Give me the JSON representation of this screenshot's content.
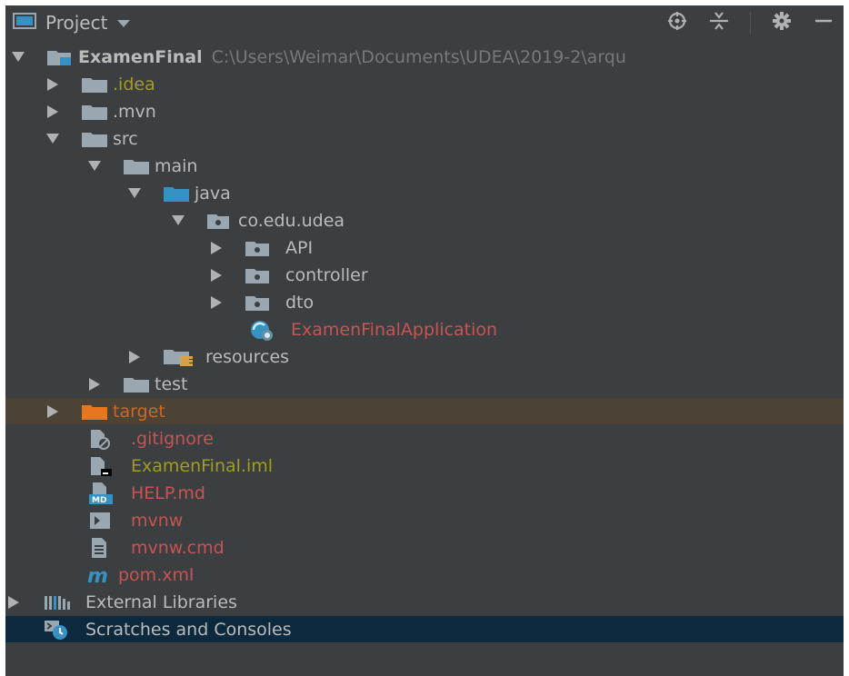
{
  "window": {
    "title": "Project"
  },
  "toolbar": {
    "icons": [
      "crosshair-icon",
      "collapse-all-icon",
      "gear-icon",
      "minimize-icon"
    ]
  },
  "tree": [
    {
      "name": "ExamenFinal",
      "path": "C:\\Users\\Weimar\\Documents\\UDEA\\2019-2\\arqu",
      "icon": "project-folder-icon",
      "expanded": true,
      "color": "#bbbbbb"
    },
    {
      "name": ".idea",
      "icon": "folder-icon",
      "expanded": false,
      "color": "#a29d1e"
    },
    {
      "name": ".mvn",
      "icon": "folder-icon",
      "expanded": false,
      "color": "#bbbbbb"
    },
    {
      "name": "src",
      "icon": "folder-icon",
      "expanded": true,
      "color": "#bbbbbb"
    },
    {
      "name": "main",
      "icon": "folder-icon",
      "expanded": true,
      "color": "#bbbbbb"
    },
    {
      "name": "java",
      "icon": "source-folder-icon",
      "expanded": true,
      "color": "#bbbbbb"
    },
    {
      "name": "co.edu.udea",
      "icon": "package-icon",
      "expanded": true,
      "color": "#bbbbbb"
    },
    {
      "name": "API",
      "icon": "package-icon",
      "expanded": false,
      "color": "#bbbbbb"
    },
    {
      "name": "controller",
      "icon": "package-icon",
      "expanded": false,
      "color": "#bbbbbb"
    },
    {
      "name": "dto",
      "icon": "package-icon",
      "expanded": false,
      "color": "#bbbbbb"
    },
    {
      "name": "ExamenFinalApplication",
      "icon": "spring-boot-class-icon",
      "color": "#c75450"
    },
    {
      "name": "resources",
      "icon": "resources-folder-icon",
      "expanded": false,
      "color": "#bbbbbb"
    },
    {
      "name": "test",
      "icon": "folder-icon",
      "expanded": false,
      "color": "#bbbbbb"
    },
    {
      "name": "target",
      "icon": "excluded-folder-icon",
      "expanded": false,
      "color": "#d1661f"
    },
    {
      "name": ".gitignore",
      "icon": "ignore-file-icon",
      "color": "#c75450"
    },
    {
      "name": "ExamenFinal.iml",
      "icon": "iml-file-icon",
      "color": "#a29d1e"
    },
    {
      "name": "HELP.md",
      "icon": "markdown-file-icon",
      "color": "#c75450"
    },
    {
      "name": "mvnw",
      "icon": "shell-script-icon",
      "color": "#c75450"
    },
    {
      "name": "mvnw.cmd",
      "icon": "text-file-icon",
      "color": "#c75450"
    },
    {
      "name": "pom.xml",
      "icon": "maven-icon",
      "color": "#c75450"
    },
    {
      "name": "External Libraries",
      "icon": "libraries-icon",
      "expanded": false,
      "color": "#bbbbbb"
    },
    {
      "name": "Scratches and Consoles",
      "icon": "scratches-icon",
      "color": "#bbbbbb"
    }
  ]
}
